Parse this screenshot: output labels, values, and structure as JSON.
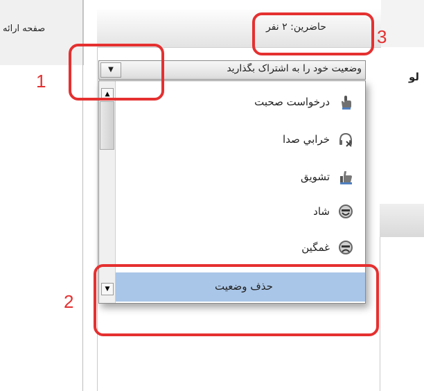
{
  "left_tab": {
    "label": "صفحه ارائه"
  },
  "header": {
    "attendees": "حاضرين: ۲ نفر"
  },
  "status_combo": {
    "selected_text": "وضعيت خود را به اشتراک بگذاريد"
  },
  "status_options": [
    {
      "label": "درخواست صحبت",
      "icon": "hand-raise-icon"
    },
    {
      "label": "خرابي صدا",
      "icon": "headset-muted-icon"
    },
    {
      "label": "تشويق",
      "icon": "thumbs-up-icon"
    },
    {
      "label": "شاد",
      "icon": "happy-face-icon"
    },
    {
      "label": "غمگين",
      "icon": "sad-face-icon"
    }
  ],
  "remove_status": {
    "label": "حذف وضعيت"
  },
  "right_partial": {
    "text": "لو"
  },
  "annotations": [
    {
      "number": "1"
    },
    {
      "number": "2"
    },
    {
      "number": "3"
    }
  ],
  "colors": {
    "annotation": "#e53030",
    "selected_item_bg": "#a9c6e8"
  }
}
